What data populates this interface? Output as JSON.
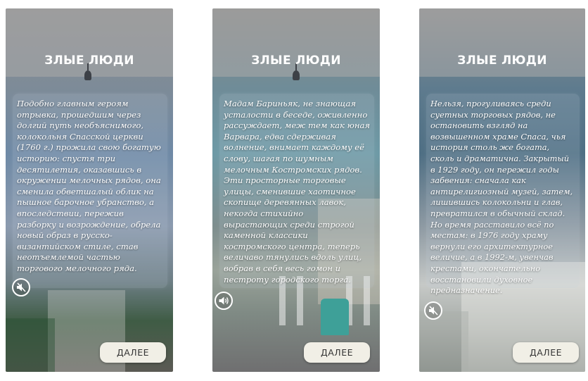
{
  "screens": [
    {
      "title": "ЗЛЫЕ ЛЮДИ",
      "text": "Подобно главным героям\nотрывка, прошедшим через\nдолгий путь необъяснимого,\nколокольня Спасской церкви\n(1760 г.) прожила свою богатую\nисторию: спустя три\nдесятилетия, оказавшись в\nокружении мелочных рядов, она\nсменила обветшалый облик на\nпышное барочное убранство, а\nвпоследствии, пережив\nразборку и возрождение, обрела\nновый образ в русско-\nвизантийском стиле, став\nнеотъемлемой частью\nторгового мелочного ряда.",
      "sound_icon": "sound-off-icon",
      "next_label": "ДАЛЕЕ"
    },
    {
      "title": "ЗЛЫЕ ЛЮДИ",
      "text": "Мадам Бариньяк, не знающая\nусталости в беседе, оживленно\nрассуждает, меж тем как юная\nВарвара, едва сдерживая\nволнение, внимает каждому её\nслову, шагая по шумным\nмелочным Костромских рядов.\nЭти просторные торговые\nулицы, сменившие хаотичное\nскопище деревянных лавок,\nнекогда стихийно\nвырастающих среди строгой\nкаменной классики\nкостромского центра, теперь\nвеличаво тянулись вдоль улиц,\nвобрав в себя весь гомон и\nпестроту городского торга.",
      "sound_icon": "sound-on-icon",
      "next_label": "ДАЛЕЕ"
    },
    {
      "title": "ЗЛЫЕ ЛЮДИ",
      "text": "Нельзя, прогуливаясь среди\nсуетных торговых рядов, не\nостановить взгляд на\nвозвышенном храме Спаса, чья\nистория столь же богата,\nсколь и драматична. Закрытый\nв 1929 году, он пережил годы\nзабвения: сначала как\nантирелигиозный музей, затем,\nлишившись колокольни и глав,\nпревратился в обычный склад.\nНо время расставило всё по\nместам: в 1976 году храму\nвернули его архитектурное\nвеличие, а в 1992-м, увенчав\nкрестами, окончательно\nвосстановили духовное\nпредназначение.",
      "sound_icon": "sound-off-icon",
      "next_label": "ДАЛЕЕ"
    }
  ]
}
